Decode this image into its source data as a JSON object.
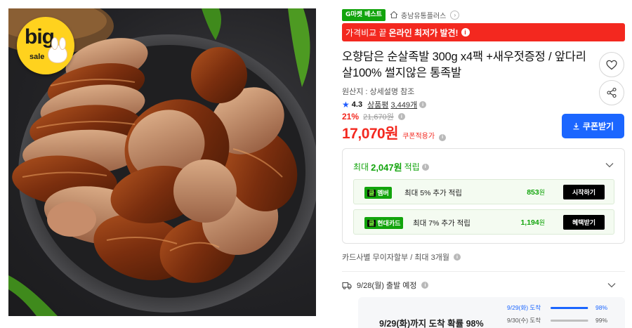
{
  "product_image": {
    "badge": {
      "big": "big",
      "sale": "sale"
    }
  },
  "header": {
    "gbest_label": "G마켓 베스트",
    "store_name": "충남유통플러스"
  },
  "price_compare_banner": {
    "prefix": "가격비교 끝",
    "emphasis": "온라인 최저가 발견!"
  },
  "product": {
    "title": "오향담은 순살족발 300g x4팩 +새우젓증정 / 앞다리살100% 썰지않은 통족발",
    "origin": "원산지 : 상세설명 참조",
    "rating": "4.3",
    "review_label": "상품평",
    "review_count": "3,449개",
    "discount_rate": "21%",
    "original_price": "21,670원",
    "price": "17,070원",
    "coupon_applied_label": "쿠폰적용가",
    "coupon_button_label": "쿠폰받기"
  },
  "rewards": {
    "header_prefix": "최대",
    "header_amount": "2,047원",
    "header_suffix": "적립",
    "items": [
      {
        "tag_k": "클",
        "tag_name": "멤버",
        "desc": "최대 5% 추가 적립",
        "value": "853",
        "unit": "원",
        "action": "시작하기"
      },
      {
        "tag_k": "클",
        "tag_name": "현대카드",
        "desc": "최대 7% 추가 적립",
        "value": "1,194",
        "unit": "원",
        "action": "혜택받기"
      }
    ]
  },
  "installment": "카드사별 무이자할부 / 최대 3개월",
  "shipping": {
    "departure": "9/28(월) 출발 예정",
    "arrival_main": "9/29(화)까지 도착 확률 98%",
    "distribution": [
      {
        "date": "9/29(화) 도착",
        "percent": "98%",
        "fraction": 0.98
      },
      {
        "date": "9/30(수) 도착",
        "percent": "99%",
        "fraction": 0.99
      }
    ]
  },
  "colors": {
    "accent_red": "#f3281f",
    "accent_blue": "#1b66ff",
    "accent_green": "#12a40c"
  },
  "icons": [
    "house-icon",
    "chevron-right-icon",
    "info-icon",
    "heart-icon",
    "share-icon",
    "star-icon",
    "download-icon",
    "chevron-down-icon",
    "truck-icon"
  ]
}
